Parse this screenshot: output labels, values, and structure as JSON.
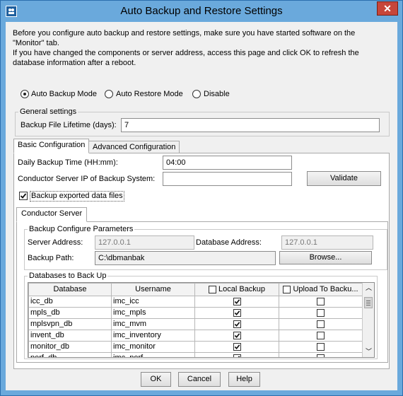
{
  "window": {
    "title": "Auto Backup and Restore Settings",
    "close_label": "✕"
  },
  "intro": {
    "line1": "Before you configure auto backup and restore settings, make sure you have started software on the",
    "line2": "\"Monitor\" tab.",
    "line3": "If you have changed the components or server address, access this page and click OK to refresh the",
    "line4": "database information after a reboot."
  },
  "mode": {
    "options": [
      "Auto Backup Mode",
      "Auto Restore Mode",
      "Disable"
    ],
    "selected": "Auto Backup Mode"
  },
  "general": {
    "legend": "General settings",
    "lifetime_label": "Backup File Lifetime (days):",
    "lifetime_value": "7"
  },
  "tabs": [
    "Basic Configuration",
    "Advanced Configuration"
  ],
  "basic": {
    "daily_time_label": "Daily Backup Time (HH:mm):",
    "daily_time_value": "04:00",
    "conductor_ip_label": "Conductor Server IP of Backup System:",
    "conductor_ip_value": "",
    "validate_label": "Validate",
    "export_label": "Backup exported data files",
    "export_checked": true
  },
  "subtab": "Conductor Server",
  "params": {
    "legend": "Backup Configure Parameters",
    "server_label": "Server Address:",
    "server_value": "127.0.0.1",
    "db_address_label": "Database Address:",
    "db_address_value": "127.0.0.1",
    "path_label": "Backup Path:",
    "path_value": "C:\\dbmanbak",
    "browse_label": "Browse..."
  },
  "databases": {
    "legend": "Databases to Back Up",
    "columns": [
      "Database",
      "Username",
      "Local Backup",
      "Upload To Backu..."
    ],
    "rows": [
      {
        "database": "icc_db",
        "username": "imc_icc",
        "local": true,
        "upload": false
      },
      {
        "database": "mpls_db",
        "username": "imc_mpls",
        "local": true,
        "upload": false
      },
      {
        "database": "mplsvpn_db",
        "username": "imc_mvm",
        "local": true,
        "upload": false
      },
      {
        "database": "invent_db",
        "username": "imc_inventory",
        "local": true,
        "upload": false
      },
      {
        "database": "monitor_db",
        "username": "imc_monitor",
        "local": true,
        "upload": false
      },
      {
        "database": "perf_db",
        "username": "imc_perf",
        "local": true,
        "upload": false
      }
    ]
  },
  "footer": {
    "ok": "OK",
    "cancel": "Cancel",
    "help": "Help"
  },
  "colors": {
    "titlebar": "#6aa9dc",
    "close": "#c7463a",
    "dialog_bg": "#f0f0f0"
  }
}
